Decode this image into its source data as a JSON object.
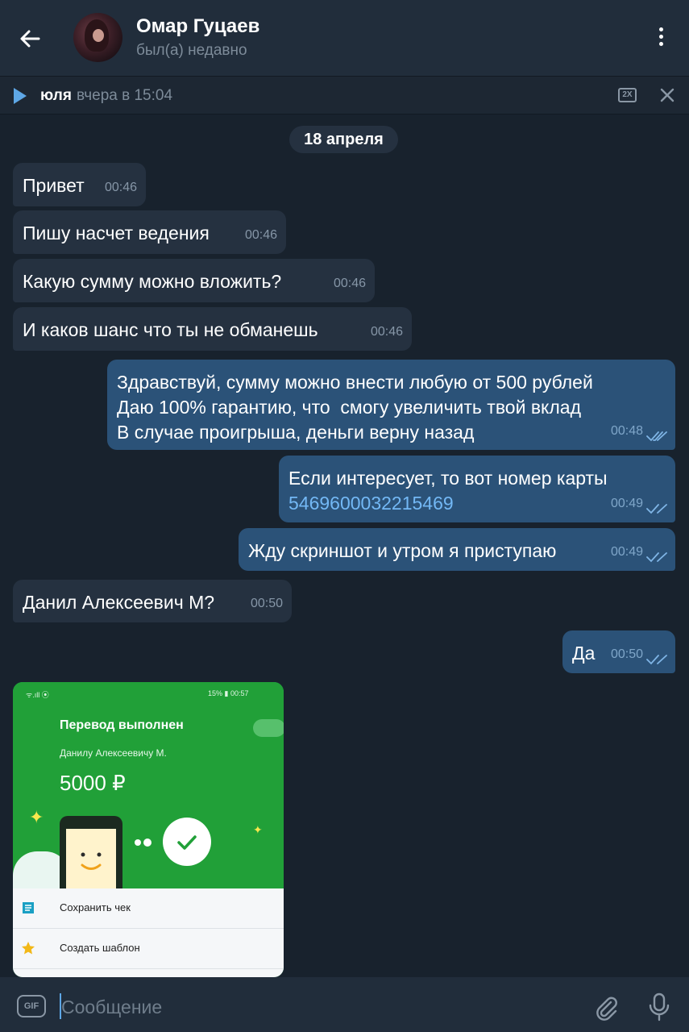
{
  "header": {
    "contact_name": "Омар Гуцаев",
    "status": "был(а) недавно"
  },
  "audio_bar": {
    "sender": "юля",
    "time": "вчера в 15:04",
    "speed": "2X"
  },
  "date_separator": "18 апреля",
  "messages": [
    {
      "direction": "in",
      "text": "Привет",
      "time": "00:46"
    },
    {
      "direction": "in",
      "text": "Пишу насчет ведения",
      "time": "00:46"
    },
    {
      "direction": "in",
      "text": "Какую сумму можно вложить?",
      "time": "00:46"
    },
    {
      "direction": "in",
      "text": "И каков шанс что ты не обманешь",
      "time": "00:46"
    },
    {
      "direction": "out",
      "lines": [
        "Здравствуй, сумму можно внести любую от 500 рублей",
        "Даю 100% гарантию, что  смогу увеличить твой вклад",
        "В случае проигрыша, деньги верну назад"
      ],
      "time": "00:48",
      "read": true
    },
    {
      "direction": "out",
      "text": "Если интересует, то вот номер карты",
      "link": "5469600032215469",
      "time": "00:49",
      "read": true
    },
    {
      "direction": "out",
      "text": "Жду скриншот и утром я приступаю",
      "time": "00:49",
      "read": true
    },
    {
      "direction": "in",
      "text": "Данил Алексеевич М?",
      "time": "00:50"
    },
    {
      "direction": "out",
      "text": "Да",
      "time": "00:50",
      "read": true
    }
  ],
  "photo": {
    "status_left": "ᯤ.ıll ⦿",
    "status_right": "15% ▮ 00:57",
    "title": "Перевод выполнен",
    "recipient": "Данилу Алексеевичу М.",
    "amount": "5000 ₽",
    "actions": [
      {
        "icon": "receipt-icon",
        "label": "Сохранить чек"
      },
      {
        "icon": "star-icon",
        "label": "Создать шаблон"
      }
    ]
  },
  "composer": {
    "placeholder": "Сообщение",
    "gif_label": "GIF"
  },
  "colors": {
    "background": "#18222d",
    "header": "#212d3b",
    "incoming_bubble": "#253140",
    "outgoing_bubble": "#2b5278",
    "accent": "#5ea7e6",
    "sber_green": "#21a038"
  }
}
